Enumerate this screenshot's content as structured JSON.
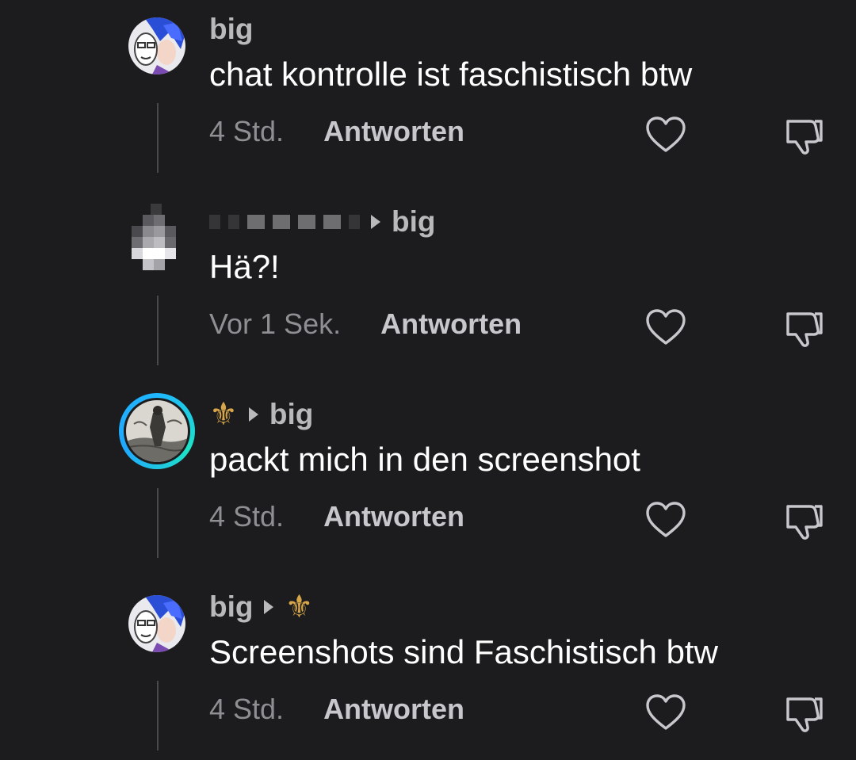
{
  "comments": [
    {
      "author": "big",
      "text": "chat kontrolle ist faschistisch btw",
      "time": "4 Std.",
      "reply_label": "Antworten",
      "avatar_icon": "anime-avatar-icon"
    },
    {
      "author_hidden": true,
      "reply_to": "big",
      "text": "Hä?!",
      "time": "Vor 1 Sek.",
      "reply_label": "Antworten",
      "avatar_icon": "pixelated-avatar-icon"
    },
    {
      "author_symbol": "⚜",
      "reply_to": "big",
      "text": "packt mich in den screenshot",
      "time": "4 Std.",
      "reply_label": "Antworten",
      "avatar_icon": "engraving-avatar-icon",
      "story_ring_color": "#1fb6ff"
    },
    {
      "author": "big",
      "reply_to_symbol": "⚜",
      "text": "Screenshots sind Faschistisch btw",
      "time": "4 Std.",
      "reply_label": "Antworten",
      "avatar_icon": "anime-avatar-icon"
    }
  ],
  "icons": {
    "like": "heart-outline-icon",
    "dislike": "thumbs-down-outline-icon"
  },
  "colors": {
    "background": "#1c1c1e",
    "fleur_de_lis": "#d8a64a"
  }
}
